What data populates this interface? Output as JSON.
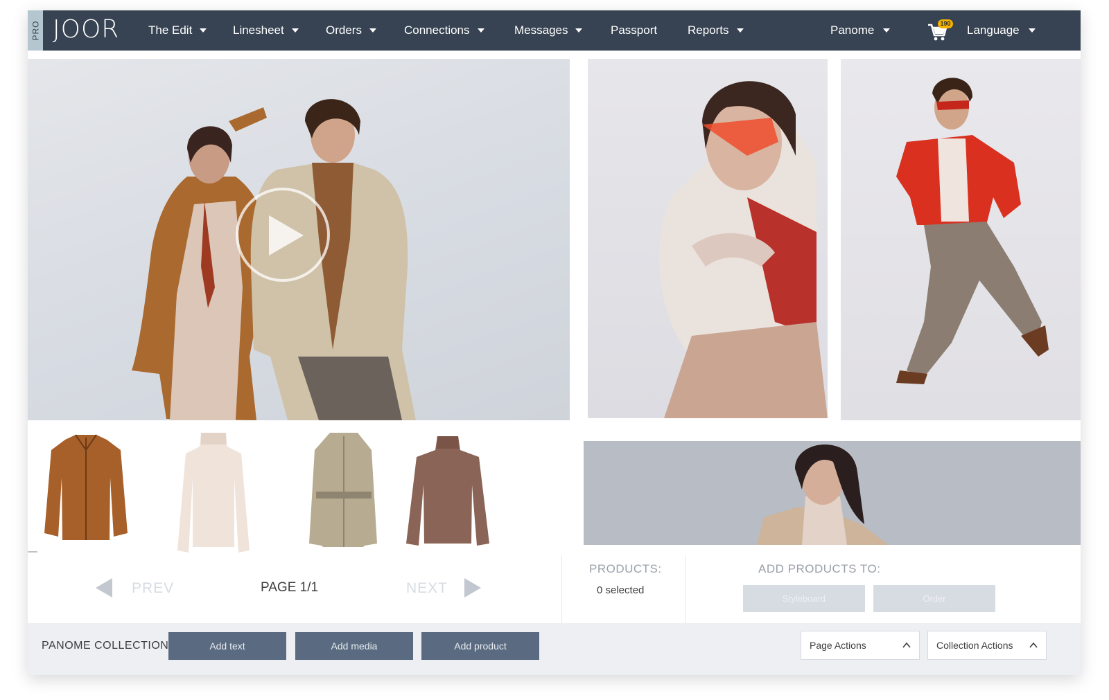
{
  "nav": {
    "pro_badge": "PRO",
    "logo": "JOOR",
    "items": [
      {
        "label": "The Edit",
        "dropdown": true
      },
      {
        "label": "Linesheet",
        "dropdown": true
      },
      {
        "label": "Orders",
        "dropdown": true
      },
      {
        "label": "Connections",
        "dropdown": true
      },
      {
        "label": "Messages",
        "dropdown": true
      },
      {
        "label": "Passport",
        "dropdown": false
      },
      {
        "label": "Reports",
        "dropdown": true
      }
    ],
    "account": "Panome",
    "cart_count": "190",
    "language": "Language"
  },
  "media": {
    "hero_icon": "play-icon",
    "thumbnails": [
      "leather-jacket",
      "turtleneck-top",
      "trench-coat",
      "knit-sweater"
    ]
  },
  "pagination": {
    "prev": "PREV",
    "page": "PAGE 1/1",
    "next": "NEXT"
  },
  "products": {
    "label": "PRODUCTS:",
    "selected": "0 selected",
    "add_to_label": "ADD PRODUCTS TO:",
    "buttons": [
      "Styleboard",
      "Order"
    ]
  },
  "bottom": {
    "collection": "PANOME COLLECTION",
    "add_text": "Add text",
    "add_media": "Add media",
    "add_product": "Add product",
    "page_actions": "Page Actions",
    "collection_actions": "Collection Actions"
  },
  "colors": {
    "nav_bg": "#374352",
    "action_button": "#5a6b81",
    "badge": "#f3b300",
    "disabled": "#d7dbe2"
  }
}
